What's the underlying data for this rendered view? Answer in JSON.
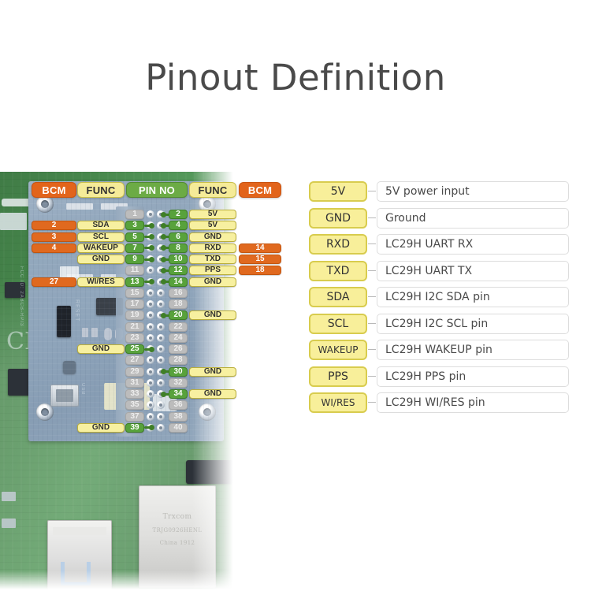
{
  "page": {
    "title": "Pinout Definition",
    "background": "#ffffff"
  },
  "colors": {
    "bcm_orange": "#e2641b",
    "func_yellow": "#f5eb98",
    "pin_green": "#6cab45",
    "inactive_gray": "#bcbcbc",
    "legend_badge_yellow": "#f8ef9a",
    "title_gray": "#4a4a4a",
    "pcb_green": "#47874c",
    "hat_blue": "#93a8bd"
  },
  "pinout": {
    "headers": {
      "bcm_left": "BCM",
      "func_left": "FUNC",
      "pin_no": "PIN NO",
      "func_right": "FUNC",
      "bcm_right": "BCM"
    },
    "rows": [
      {
        "left_bcm": "",
        "left_func": "",
        "pin_odd": "1",
        "pin_even": "2",
        "right_func": "5V",
        "right_bcm": "",
        "odd_active": false,
        "even_active": true
      },
      {
        "left_bcm": "2",
        "left_func": "SDA",
        "pin_odd": "3",
        "pin_even": "4",
        "right_func": "5V",
        "right_bcm": "",
        "odd_active": true,
        "even_active": true
      },
      {
        "left_bcm": "3",
        "left_func": "SCL",
        "pin_odd": "5",
        "pin_even": "6",
        "right_func": "GND",
        "right_bcm": "",
        "odd_active": true,
        "even_active": true
      },
      {
        "left_bcm": "4",
        "left_func": "WAKEUP",
        "pin_odd": "7",
        "pin_even": "8",
        "right_func": "RXD",
        "right_bcm": "14",
        "odd_active": true,
        "even_active": true
      },
      {
        "left_bcm": "",
        "left_func": "GND",
        "pin_odd": "9",
        "pin_even": "10",
        "right_func": "TXD",
        "right_bcm": "15",
        "odd_active": true,
        "even_active": true
      },
      {
        "left_bcm": "",
        "left_func": "",
        "pin_odd": "11",
        "pin_even": "12",
        "right_func": "PPS",
        "right_bcm": "18",
        "odd_active": false,
        "even_active": true
      },
      {
        "left_bcm": "27",
        "left_func": "WI/RES",
        "pin_odd": "13",
        "pin_even": "14",
        "right_func": "GND",
        "right_bcm": "",
        "odd_active": true,
        "even_active": true
      },
      {
        "left_bcm": "",
        "left_func": "",
        "pin_odd": "15",
        "pin_even": "16",
        "right_func": "",
        "right_bcm": "",
        "odd_active": false,
        "even_active": false
      },
      {
        "left_bcm": "",
        "left_func": "",
        "pin_odd": "17",
        "pin_even": "18",
        "right_func": "",
        "right_bcm": "",
        "odd_active": false,
        "even_active": false
      },
      {
        "left_bcm": "",
        "left_func": "",
        "pin_odd": "19",
        "pin_even": "20",
        "right_func": "GND",
        "right_bcm": "",
        "odd_active": false,
        "even_active": true
      },
      {
        "left_bcm": "",
        "left_func": "",
        "pin_odd": "21",
        "pin_even": "22",
        "right_func": "",
        "right_bcm": "",
        "odd_active": false,
        "even_active": false
      },
      {
        "left_bcm": "",
        "left_func": "",
        "pin_odd": "23",
        "pin_even": "24",
        "right_func": "",
        "right_bcm": "",
        "odd_active": false,
        "even_active": false
      },
      {
        "left_bcm": "",
        "left_func": "GND",
        "pin_odd": "25",
        "pin_even": "26",
        "right_func": "",
        "right_bcm": "",
        "odd_active": true,
        "even_active": false
      },
      {
        "left_bcm": "",
        "left_func": "",
        "pin_odd": "27",
        "pin_even": "28",
        "right_func": "",
        "right_bcm": "",
        "odd_active": false,
        "even_active": false
      },
      {
        "left_bcm": "",
        "left_func": "",
        "pin_odd": "29",
        "pin_even": "30",
        "right_func": "GND",
        "right_bcm": "",
        "odd_active": false,
        "even_active": true
      },
      {
        "left_bcm": "",
        "left_func": "",
        "pin_odd": "31",
        "pin_even": "32",
        "right_func": "",
        "right_bcm": "",
        "odd_active": false,
        "even_active": false
      },
      {
        "left_bcm": "",
        "left_func": "",
        "pin_odd": "33",
        "pin_even": "34",
        "right_func": "GND",
        "right_bcm": "",
        "odd_active": false,
        "even_active": true
      },
      {
        "left_bcm": "",
        "left_func": "",
        "pin_odd": "35",
        "pin_even": "36",
        "right_func": "",
        "right_bcm": "",
        "odd_active": false,
        "even_active": false
      },
      {
        "left_bcm": "",
        "left_func": "",
        "pin_odd": "37",
        "pin_even": "38",
        "right_func": "",
        "right_bcm": "",
        "odd_active": false,
        "even_active": false
      },
      {
        "left_bcm": "",
        "left_func": "GND",
        "pin_odd": "39",
        "pin_even": "40",
        "right_func": "",
        "right_bcm": "",
        "odd_active": true,
        "even_active": false
      }
    ]
  },
  "legend": {
    "items": [
      {
        "signal": "5V",
        "description": "5V power input"
      },
      {
        "signal": "GND",
        "description": "Ground"
      },
      {
        "signal": "RXD",
        "description": "LC29H UART RX"
      },
      {
        "signal": "TXD",
        "description": "LC29H UART TX"
      },
      {
        "signal": "SDA",
        "description": "LC29H I2C SDA pin"
      },
      {
        "signal": "SCL",
        "description": "LC29H I2C SCL pin"
      },
      {
        "signal": "WAKEUP",
        "description": "LC29H WAKEUP pin"
      },
      {
        "signal": "PPS",
        "description": "LC29H PPS pin"
      },
      {
        "signal": "WI/RES",
        "description": "LC29H WI/RES pin"
      }
    ]
  },
  "pcb_silkscreen": {
    "fcc": "FCC ID: 2ABCB-RPI3",
    "ic": "IC: 20953 RPI4B",
    "ethernet_mark": "Trxcom",
    "ethernet_part": "TRJG0926HENL",
    "ethernet_origin": "China  1912",
    "reset_label": "RESET",
    "usb_label": "USB",
    "ce_mark": "CE"
  }
}
